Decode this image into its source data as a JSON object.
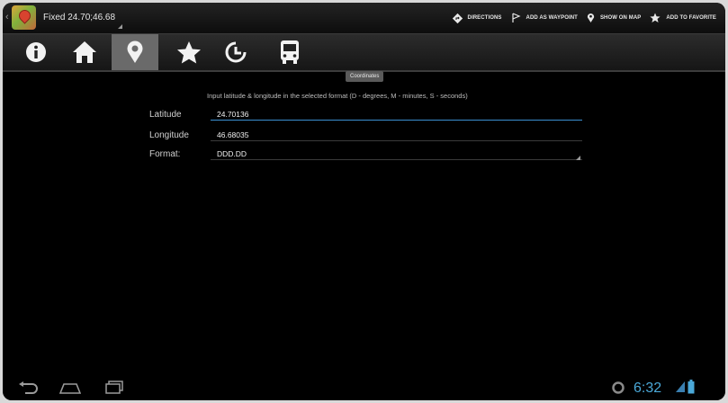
{
  "app": {
    "title": "Fixed 24.70;46.68"
  },
  "actions": {
    "directions": "DIRECTIONS",
    "add_waypoint": "ADD AS WAYPOINT",
    "show_on_map": "SHOW ON MAP",
    "add_favorite": "ADD TO FAVORITE"
  },
  "tabs": [
    {
      "icon": "info-icon"
    },
    {
      "icon": "home-icon"
    },
    {
      "icon": "location-pin-icon"
    },
    {
      "icon": "star-icon"
    },
    {
      "icon": "history-icon"
    },
    {
      "icon": "bus-icon"
    }
  ],
  "selected_tab_tooltip": "Coordinates",
  "form": {
    "hint": "Input latitude & longitude in the selected format (D - degrees, M - minutes, S - seconds)",
    "latitude_label": "Latitude",
    "latitude_value": "24.70136",
    "longitude_label": "Longitude",
    "longitude_value": "46.68035",
    "format_label": "Format:",
    "format_value": "DDD.DD"
  },
  "status": {
    "time": "6:32"
  },
  "colors": {
    "accent": "#3a8fd0",
    "clock": "#4aa8d8"
  }
}
